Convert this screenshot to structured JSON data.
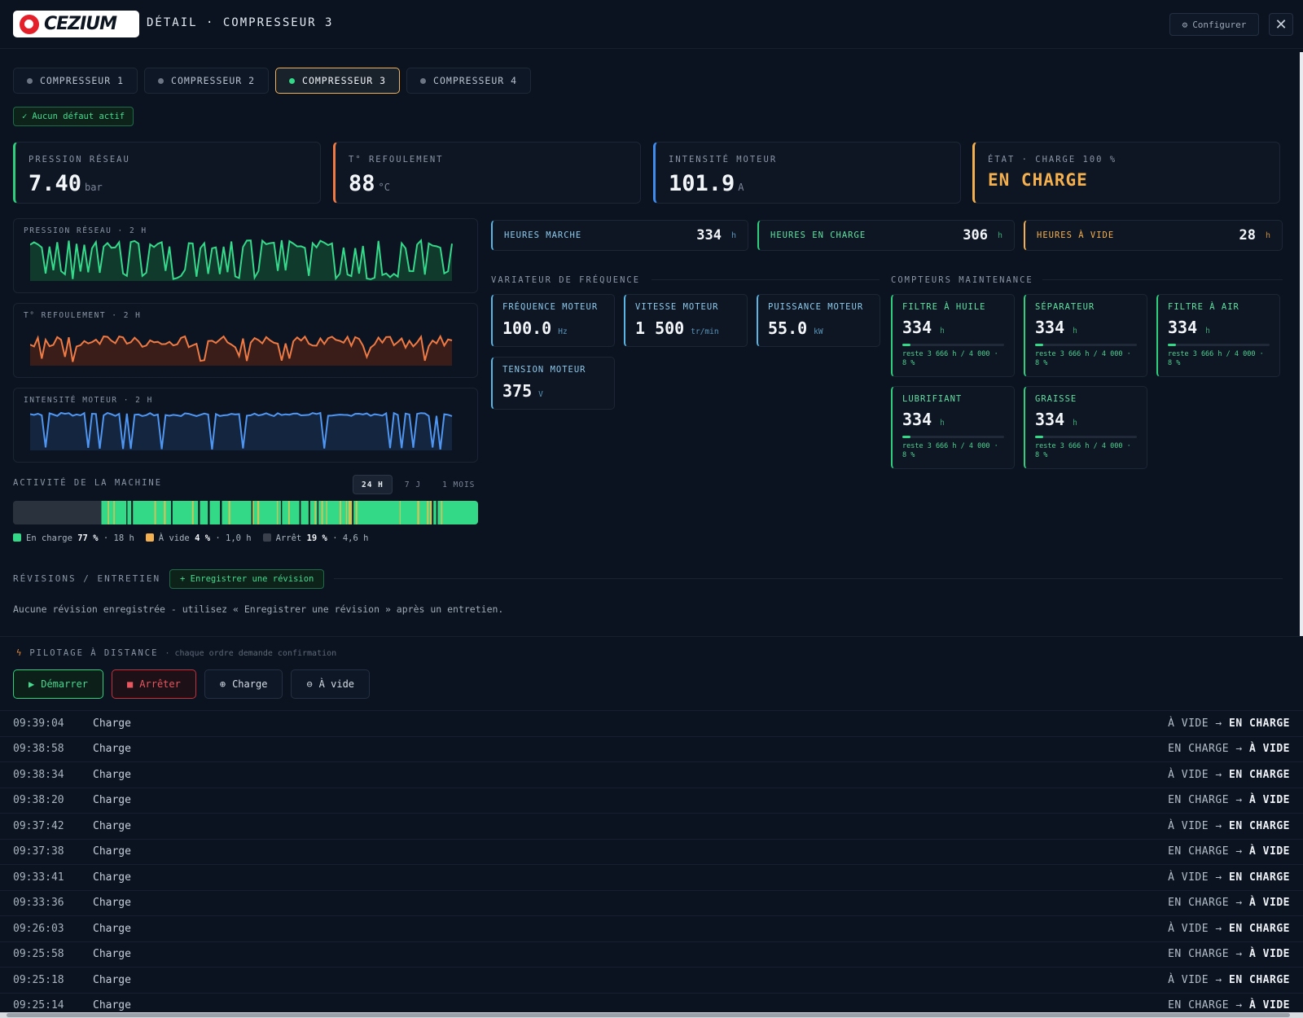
{
  "header": {
    "logo_text": "CEZIUM",
    "title": "DÉTAIL · COMPRESSEUR 3",
    "config_label": "Configurer",
    "config_icon": "gear-icon",
    "close_icon": "close-icon"
  },
  "tabs": [
    {
      "label": "COMPRESSEUR 1",
      "active": false
    },
    {
      "label": "COMPRESSEUR 2",
      "active": false
    },
    {
      "label": "COMPRESSEUR 3",
      "active": true
    },
    {
      "label": "COMPRESSEUR 4",
      "active": false
    }
  ],
  "status_badge": {
    "icon": "check-icon",
    "text": "Aucun défaut actif"
  },
  "kpis": {
    "pressure": {
      "label": "PRESSION RÉSEAU",
      "value": "7.40",
      "unit": "bar",
      "color": "#2ecf7d"
    },
    "temperature": {
      "label": "T° REFOULEMENT",
      "value": "88",
      "unit": "°C",
      "color": "#f07a44"
    },
    "current": {
      "label": "INTENSITÉ MOTEUR",
      "value": "101.9",
      "unit": "A",
      "color": "#3f8cf0"
    },
    "state": {
      "label": "ÉTAT · CHARGE 100 %",
      "value": "EN CHARGE",
      "color": "#f4b04e"
    }
  },
  "trend_charts": {
    "pressure": {
      "label": "PRESSION RÉSEAU · 2 H",
      "color": "#34d98a",
      "fill": "#0f3a2c"
    },
    "temperature": {
      "label": "T° REFOULEMENT · 2 H",
      "color": "#f07a44",
      "fill": "#3a1d18"
    },
    "current": {
      "label": "INTENSITÉ MOTEUR · 2 H",
      "color": "#4f96f2",
      "fill": "#13253f"
    }
  },
  "activity": {
    "title": "ACTIVITÉ DE LA MACHINE",
    "ranges": [
      {
        "label": "24 H",
        "active": true
      },
      {
        "label": "7 J",
        "active": false
      },
      {
        "label": "1 MOIS",
        "active": false
      }
    ],
    "stopped_fraction": 0.19,
    "legend": [
      {
        "label": "En charge",
        "pct": "77 %",
        "duration": "· 18 h",
        "color": "#34d987"
      },
      {
        "label": "À vide",
        "pct": "4 %",
        "duration": "· 1,0 h",
        "color": "#f4b04e"
      },
      {
        "label": "Arrêt",
        "pct": "19 %",
        "duration": "· 4,6 h",
        "color": "#3a414c"
      }
    ]
  },
  "hours": {
    "run": {
      "label": "HEURES MARCHE",
      "value": "334",
      "unit": "h",
      "color": "#5bb6e4"
    },
    "load": {
      "label": "HEURES EN CHARGE",
      "value": "306",
      "unit": "h",
      "color": "#2ecf7d"
    },
    "idle": {
      "label": "HEURES À VIDE",
      "value": "28",
      "unit": "h",
      "color": "#f4b04e"
    }
  },
  "vfd": {
    "title": "VARIATEUR DE FRÉQUENCE",
    "items": [
      {
        "label": "FRÉQUENCE MOTEUR",
        "value": "100.0",
        "unit": "Hz"
      },
      {
        "label": "VITESSE MOTEUR",
        "value": "1 500",
        "unit": "tr/min"
      },
      {
        "label": "PUISSANCE MOTEUR",
        "value": "55.0",
        "unit": "kW"
      },
      {
        "label": "TENSION MOTEUR",
        "value": "375",
        "unit": "V"
      }
    ]
  },
  "maintenance": {
    "title": "COMPTEURS MAINTENANCE",
    "items": [
      {
        "label": "FILTRE À HUILE",
        "value": "334",
        "unit": "h",
        "progress": 0.08,
        "sub": "reste 3 666 h / 4 000 · 8 %"
      },
      {
        "label": "SÉPARATEUR",
        "value": "334",
        "unit": "h",
        "progress": 0.08,
        "sub": "reste 3 666 h / 4 000 · 8 %"
      },
      {
        "label": "FILTRE À AIR",
        "value": "334",
        "unit": "h",
        "progress": 0.08,
        "sub": "reste 3 666 h / 4 000 · 8 %"
      },
      {
        "label": "LUBRIFIANT",
        "value": "334",
        "unit": "h",
        "progress": 0.08,
        "sub": "reste 3 666 h / 4 000 · 8 %"
      },
      {
        "label": "GRAISSE",
        "value": "334",
        "unit": "h",
        "progress": 0.08,
        "sub": "reste 3 666 h / 4 000 · 8 %"
      }
    ]
  },
  "revisions": {
    "title": "RÉVISIONS / ENTRETIEN",
    "add_label": "+ Enregistrer une révision",
    "empty_text": "Aucune révision enregistrée - utilisez « Enregistrer une révision » après un entretien."
  },
  "pilot": {
    "icon": "bolt-icon",
    "title": "PILOTAGE À DISTANCE",
    "subtitle": "· chaque ordre demande confirmation",
    "buttons": {
      "start": "Démarrer",
      "stop": "Arrêter",
      "load": "Charge",
      "idle": "À vide"
    },
    "log": [
      {
        "time": "09:39:04",
        "action": "Charge",
        "from": "À VIDE",
        "to": "EN CHARGE"
      },
      {
        "time": "09:38:58",
        "action": "Charge",
        "from": "EN CHARGE",
        "to": "À VIDE"
      },
      {
        "time": "09:38:34",
        "action": "Charge",
        "from": "À VIDE",
        "to": "EN CHARGE"
      },
      {
        "time": "09:38:20",
        "action": "Charge",
        "from": "EN CHARGE",
        "to": "À VIDE"
      },
      {
        "time": "09:37:42",
        "action": "Charge",
        "from": "À VIDE",
        "to": "EN CHARGE"
      },
      {
        "time": "09:37:38",
        "action": "Charge",
        "from": "EN CHARGE",
        "to": "À VIDE"
      },
      {
        "time": "09:33:41",
        "action": "Charge",
        "from": "À VIDE",
        "to": "EN CHARGE"
      },
      {
        "time": "09:33:36",
        "action": "Charge",
        "from": "EN CHARGE",
        "to": "À VIDE"
      },
      {
        "time": "09:26:03",
        "action": "Charge",
        "from": "À VIDE",
        "to": "EN CHARGE"
      },
      {
        "time": "09:25:58",
        "action": "Charge",
        "from": "EN CHARGE",
        "to": "À VIDE"
      },
      {
        "time": "09:25:18",
        "action": "Charge",
        "from": "À VIDE",
        "to": "EN CHARGE"
      },
      {
        "time": "09:25:14",
        "action": "Charge",
        "from": "EN CHARGE",
        "to": "À VIDE"
      }
    ]
  }
}
